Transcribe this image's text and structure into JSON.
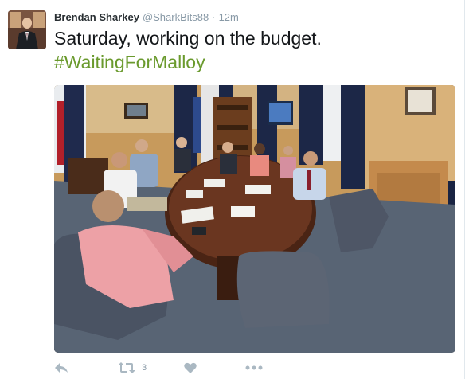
{
  "tweet": {
    "author_name": "Brendan Sharkey",
    "screen_name": "@SharkBits88",
    "separator": "·",
    "time": "12m",
    "text": "Saturday, working on the budget.",
    "hashtag": "#WaitingForMalloy"
  },
  "actions": {
    "reply_icon": "reply-icon",
    "retweet_icon": "retweet-icon",
    "retweet_count": "3",
    "like_icon": "heart-icon",
    "more_icon": "more-icon"
  },
  "colors": {
    "hashtag": "#6a9a2d",
    "muted": "#8899a6",
    "icon": "#aab8c2"
  }
}
